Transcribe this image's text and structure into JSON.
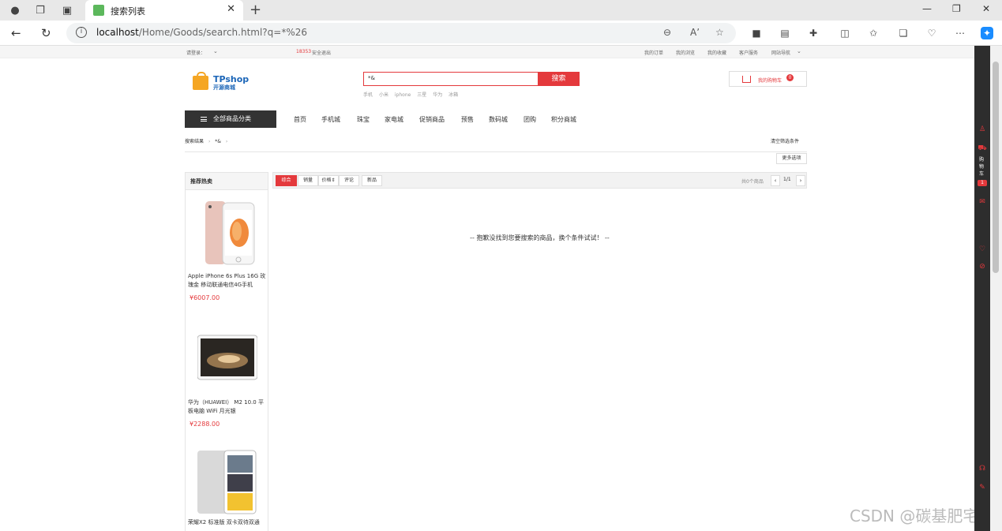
{
  "browser": {
    "tab_title": "搜索列表",
    "url_host": "localhost",
    "url_path": "/Home/Goods/search.html?q=*%26",
    "zoom_icon": "zoom-out-icon",
    "read_aloud": "Aʼ"
  },
  "topbar": {
    "welcome": "请登录：",
    "user": "18353",
    "logout": "安全退出",
    "links": [
      "我的订单",
      "我的浏览",
      "我的收藏",
      "客户服务",
      "网站导航"
    ]
  },
  "logo": {
    "brand": "TPshop",
    "sub": "开源商城"
  },
  "search": {
    "value": "*&",
    "button": "搜索",
    "hotwords": [
      "手机",
      "小米",
      "iphone",
      "三星",
      "华为",
      "冰箱"
    ]
  },
  "cart": {
    "label": "我的购物车",
    "count": "0"
  },
  "nav": {
    "all_categories": "全部商品分类",
    "items": [
      "首页",
      "手机城",
      "珠宝",
      "家电城",
      "促销商品",
      "预售",
      "数码城",
      "团购",
      "积分商城"
    ]
  },
  "breadcrumb": {
    "root": "搜索结果",
    "query": "*&",
    "clear": "清空筛选条件"
  },
  "more_options": "更多选项",
  "sidebar": {
    "title": "推荐热卖",
    "products": [
      {
        "name": "Apple iPhone 6s Plus 16G 玫瑰金 移动联通电信4G手机",
        "price": "¥6007.00"
      },
      {
        "name": "华为（HUAWEI） M2 10.0 平板电脑 WiFi 月光银",
        "price": "¥2288.00"
      },
      {
        "name": "荣耀X2 标准版 双卡双待双通",
        "price": ""
      }
    ]
  },
  "sortbar": {
    "options": [
      "综合",
      "销量",
      "价格",
      "评论",
      "新品"
    ],
    "price_arrow": "⇕",
    "total": "共0个商品",
    "page": "1/1",
    "prev": "‹",
    "next": "›"
  },
  "empty_message": "-- 抱歉没找到您要搜索的商品，换个条件试试！ --",
  "right_toolbar": {
    "cart_label": "购物车",
    "cart_count": "1"
  },
  "watermark": "CSDN @碳基肥宅",
  "colors": {
    "accent": "#e4393c",
    "logo_blue": "#1c66b8",
    "logo_orange": "#f5a623"
  }
}
